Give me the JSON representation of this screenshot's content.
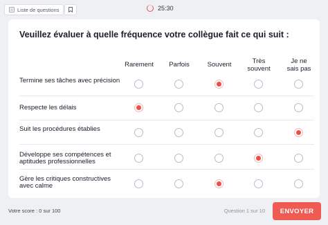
{
  "topbar": {
    "questions_list_label": "Liste de questions",
    "timer": "25:30"
  },
  "question": "Veuillez évaluer à quelle fréquence votre collègue fait ce qui suit :",
  "columns": [
    "Rarement",
    "Parfois",
    "Souvent",
    "Très\nsouvent",
    "Je ne\nsais pas"
  ],
  "rows": [
    {
      "label": "Termine ses tâches avec précision",
      "selected": 2
    },
    {
      "label": "Respecte les délais",
      "selected": 0
    },
    {
      "label": "Suit les procédures établies",
      "selected": 4
    },
    {
      "label": "Développe ses compétences et aptitudes professionnelles",
      "selected": 3
    },
    {
      "label": "Gère les critiques constructives avec calme",
      "selected": 2
    }
  ],
  "footer": {
    "score": "Votre score : 0 sur 100",
    "question_count": "Question 1 sur 10",
    "send_label": "ENVOYER"
  },
  "colors": {
    "accent": "#ef4d47"
  }
}
